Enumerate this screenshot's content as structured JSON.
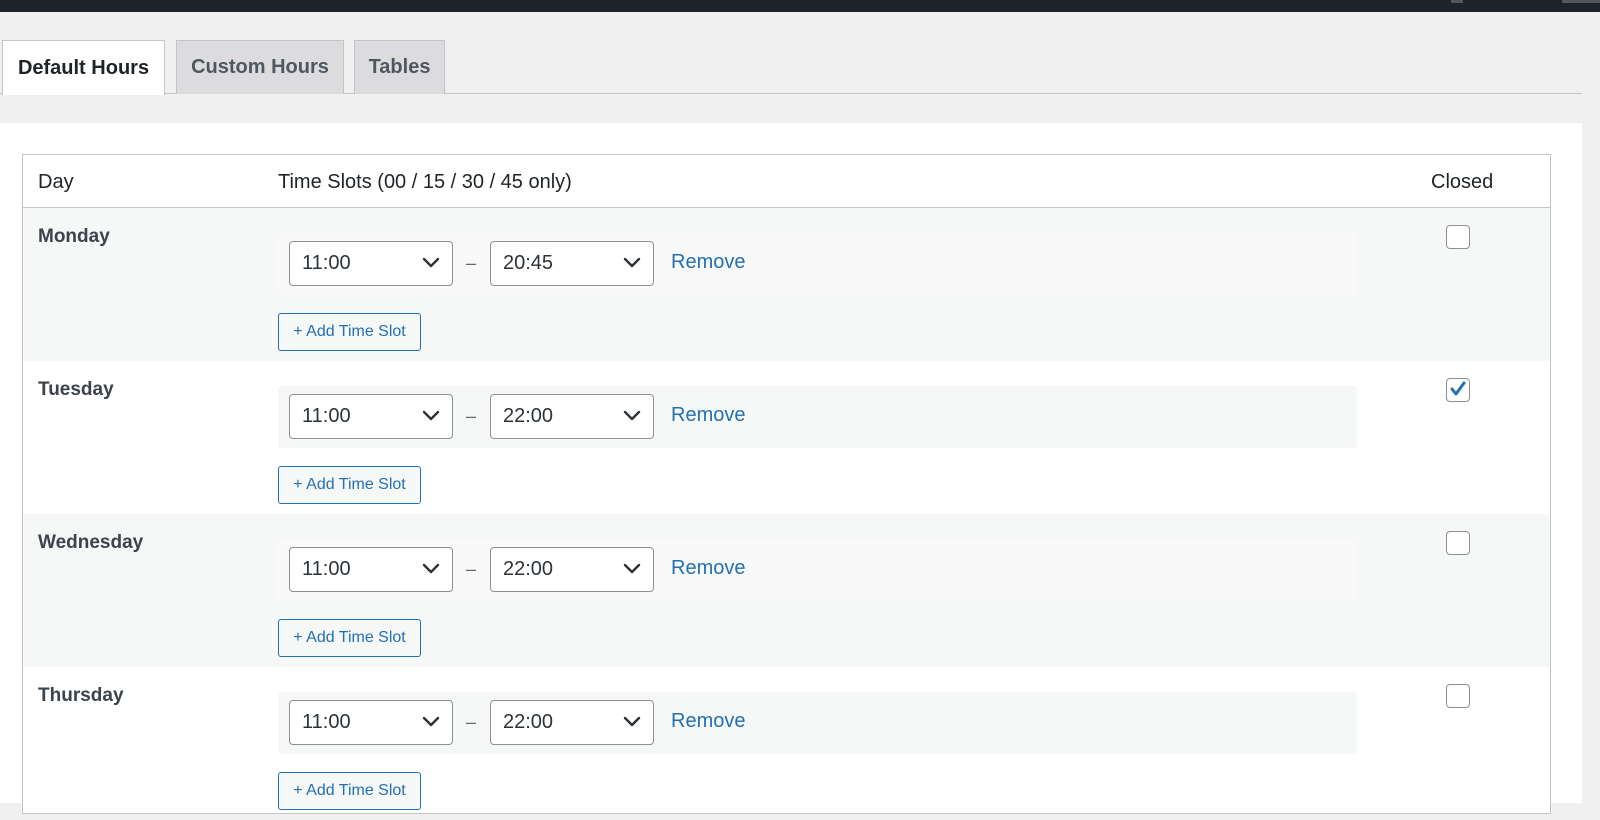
{
  "tabs": [
    {
      "label": "Default Hours",
      "active": true
    },
    {
      "label": "Custom Hours",
      "active": false
    },
    {
      "label": "Tables",
      "active": false
    }
  ],
  "table": {
    "headers": {
      "day": "Day",
      "time_slots": "Time Slots (00 / 15 / 30 / 45 only)",
      "closed": "Closed"
    }
  },
  "days": [
    {
      "name": "Monday",
      "start": "11:00",
      "end": "20:45",
      "closed": false
    },
    {
      "name": "Tuesday",
      "start": "11:00",
      "end": "22:00",
      "closed": true
    },
    {
      "name": "Wednesday",
      "start": "11:00",
      "end": "22:00",
      "closed": false
    },
    {
      "name": "Thursday",
      "start": "11:00",
      "end": "22:00",
      "closed": false
    }
  ],
  "labels": {
    "separator": "–",
    "remove": "Remove",
    "add_time_slot": "+ Add Time Slot"
  },
  "colors": {
    "accent": "#2271b1",
    "admin_bar": "#1d2327",
    "row_alt": "#f6f7f7"
  }
}
